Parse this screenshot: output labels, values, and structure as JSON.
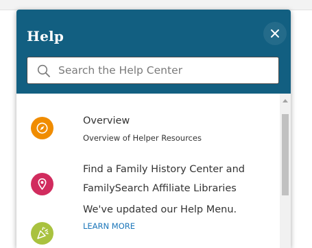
{
  "panel": {
    "title": "Help",
    "close_icon": "close-icon"
  },
  "search": {
    "placeholder": "Search the Help Center",
    "value": "",
    "icon": "search-icon"
  },
  "items": [
    {
      "title": "Overview",
      "subtitle": "Overview of Helper Resources",
      "icon": "compass-icon",
      "color": "#f08c00"
    },
    {
      "title_line1": "Find a Family History Center and",
      "title_line2": "FamilySearch Affiliate Libraries",
      "icon": "map-pin-icon",
      "color": "#d12c5e"
    },
    {
      "title": "We've updated our Help Menu.",
      "link": "LEARN MORE",
      "icon": "party-popper-icon",
      "color": "#a9c23f"
    }
  ],
  "colors": {
    "header": "#125f81",
    "link": "#1a75b9"
  }
}
